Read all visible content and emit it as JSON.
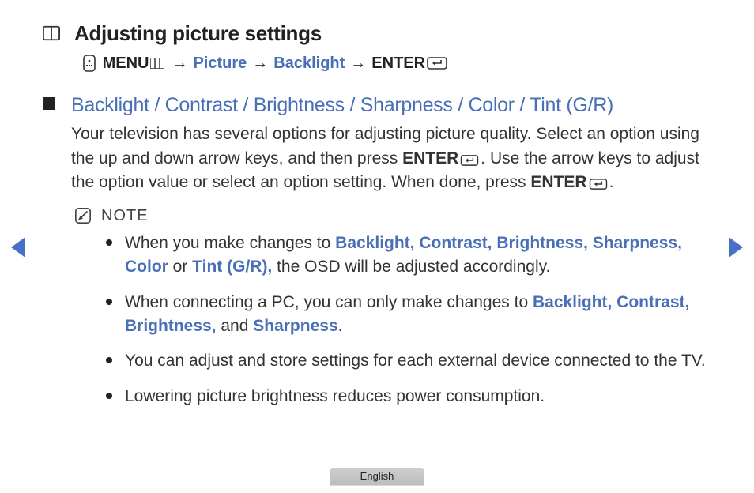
{
  "heading": "Adjusting picture settings",
  "nav": {
    "menu": "MENU",
    "picture": "Picture",
    "backlight": "Backlight",
    "enter": "ENTER"
  },
  "section": {
    "title": "Backlight / Contrast / Brightness / Sharpness / Color / Tint (G/R)",
    "para_a": "Your television has several options for adjusting picture quality. Select an option using the up and down arrow keys, and then press ",
    "para_enter1": "ENTER",
    "para_b": ". Use the arrow keys to adjust the option value or select an option setting. When done, press ",
    "para_enter2": "ENTER",
    "para_c": "."
  },
  "note": {
    "label": "NOTE",
    "items": [
      {
        "a": "When you make changes to ",
        "hl1": "Backlight, Contrast, Brightness, Sharpness, Color",
        "b": " or ",
        "hl2": "Tint (G/R),",
        "c": " the OSD will be adjusted accordingly."
      },
      {
        "a": "When connecting a PC, you can only make changes to ",
        "hl1": "Backlight, Contrast, Brightness,",
        "b": " and ",
        "hl2": "Sharpness",
        "c": "."
      },
      {
        "a": "You can adjust and store settings for each external device connected to the TV."
      },
      {
        "a": "Lowering picture brightness reduces power consumption."
      }
    ]
  },
  "language": "English"
}
